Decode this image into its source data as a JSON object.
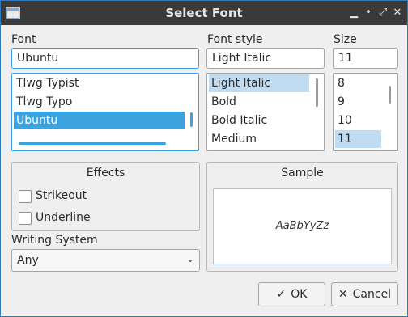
{
  "window": {
    "title": "Select Font"
  },
  "titlebar": {
    "icons": [
      "app-icon",
      "minimize-icon",
      "restore-icon",
      "maximize-icon",
      "close-icon"
    ]
  },
  "font": {
    "label": "Font",
    "value": "Ubuntu",
    "items": [
      "Tlwg Typist",
      "Tlwg Typo",
      "Ubuntu"
    ],
    "selected": "Ubuntu"
  },
  "style": {
    "label": "Font style",
    "value": "Light Italic",
    "items": [
      "Light Italic",
      "Bold",
      "Bold Italic",
      "Medium"
    ],
    "selected": "Light Italic"
  },
  "size": {
    "label": "Size",
    "value": "11",
    "items": [
      "8",
      "9",
      "10",
      "11"
    ],
    "selected": "11"
  },
  "effects": {
    "title": "Effects",
    "strikeout": {
      "label": "Strikeout",
      "checked": false
    },
    "underline": {
      "label": "Underline",
      "checked": false
    }
  },
  "sample": {
    "title": "Sample",
    "text": "AaBbYyZz"
  },
  "writing_system": {
    "label": "Writing System",
    "value": "Any"
  },
  "buttons": {
    "ok": "OK",
    "cancel": "Cancel"
  },
  "colors": {
    "accent": "#3da2e0",
    "titlebar": "#3a3a3a"
  }
}
